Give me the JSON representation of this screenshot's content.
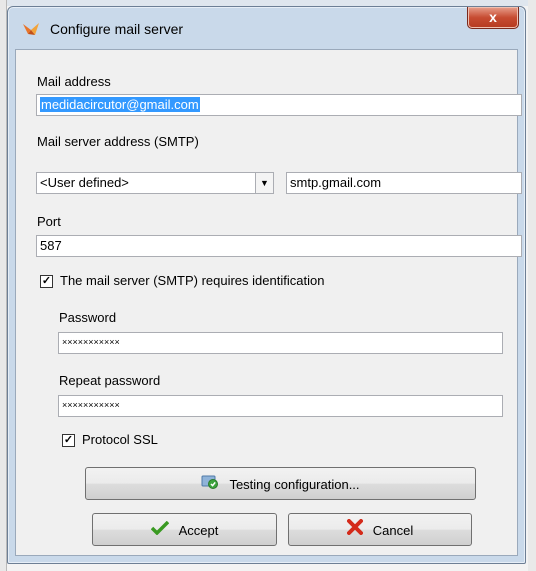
{
  "window": {
    "title": "Configure mail server",
    "close_label": "x"
  },
  "mail_address": {
    "label": "Mail address",
    "value": "medidacircutor@gmail.com"
  },
  "smtp": {
    "label": "Mail server address (SMTP)",
    "preset": "<User defined>",
    "server": "smtp.gmail.com"
  },
  "port": {
    "label": "Port",
    "value": "587"
  },
  "identification": {
    "label": "The mail server (SMTP) requires identification",
    "checked": true
  },
  "password": {
    "label": "Password",
    "value": "×××××××××××"
  },
  "repeat_password": {
    "label": "Repeat password",
    "value": "×××××××××××"
  },
  "ssl": {
    "label": "Protocol SSL",
    "checked": true
  },
  "buttons": {
    "test": "Testing configuration...",
    "accept": "Accept",
    "cancel": "Cancel"
  },
  "icons": {
    "app": "mail-server-icon",
    "test": "config-test-icon",
    "accept": "check-icon",
    "cancel": "x-icon"
  }
}
